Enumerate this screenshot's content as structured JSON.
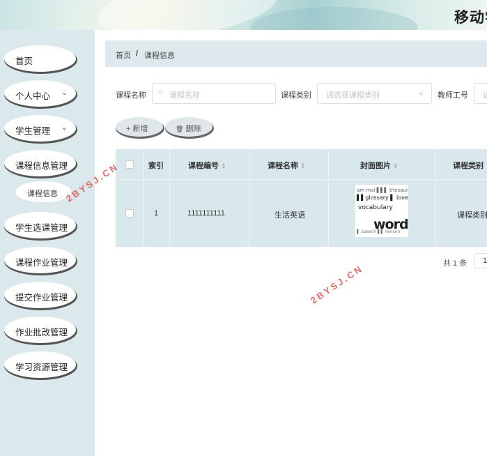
{
  "header": {
    "title": "移动学"
  },
  "sidebar": {
    "items": [
      {
        "label": "首页",
        "chevron": ""
      },
      {
        "label": "个人中心",
        "chevron": "⌄"
      },
      {
        "label": "学生管理",
        "chevron": "⌄"
      },
      {
        "label": "课程信息管理",
        "chevron": ""
      },
      {
        "label": "学生选课管理",
        "chevron": ""
      },
      {
        "label": "课程作业管理",
        "chevron": ""
      },
      {
        "label": "提交作业管理",
        "chevron": ""
      },
      {
        "label": "作业批改管理",
        "chevron": ""
      },
      {
        "label": "学习资源管理",
        "chevron": ""
      }
    ],
    "sub_items": [
      {
        "label": "课程信息"
      }
    ]
  },
  "breadcrumb": {
    "home": "首页",
    "separator": "/",
    "current": "课程信息"
  },
  "search": {
    "name_label": "课程名称",
    "name_placeholder": "课程名称",
    "type_label": "课程类别",
    "type_placeholder": "请选择课程类别",
    "teacher_label": "教师工号",
    "teacher_placeholder": "请"
  },
  "toolbar": {
    "add_label": "新增",
    "add_icon": "+",
    "delete_label": "删除",
    "delete_icon": "🗑"
  },
  "table": {
    "columns": [
      "索引",
      "课程编号",
      "课程名称",
      "封面图片",
      "课程类别"
    ],
    "rows": [
      {
        "index": "1",
        "code": "1111111111",
        "name": "生活英语",
        "category": "课程类别"
      }
    ]
  },
  "cover_words": [
    "vocabulary",
    "words"
  ],
  "pagination": {
    "total": "共 1 条",
    "page": "1"
  },
  "watermarks": [
    "2BYSJ.CN",
    "2BYSJ.CN"
  ]
}
